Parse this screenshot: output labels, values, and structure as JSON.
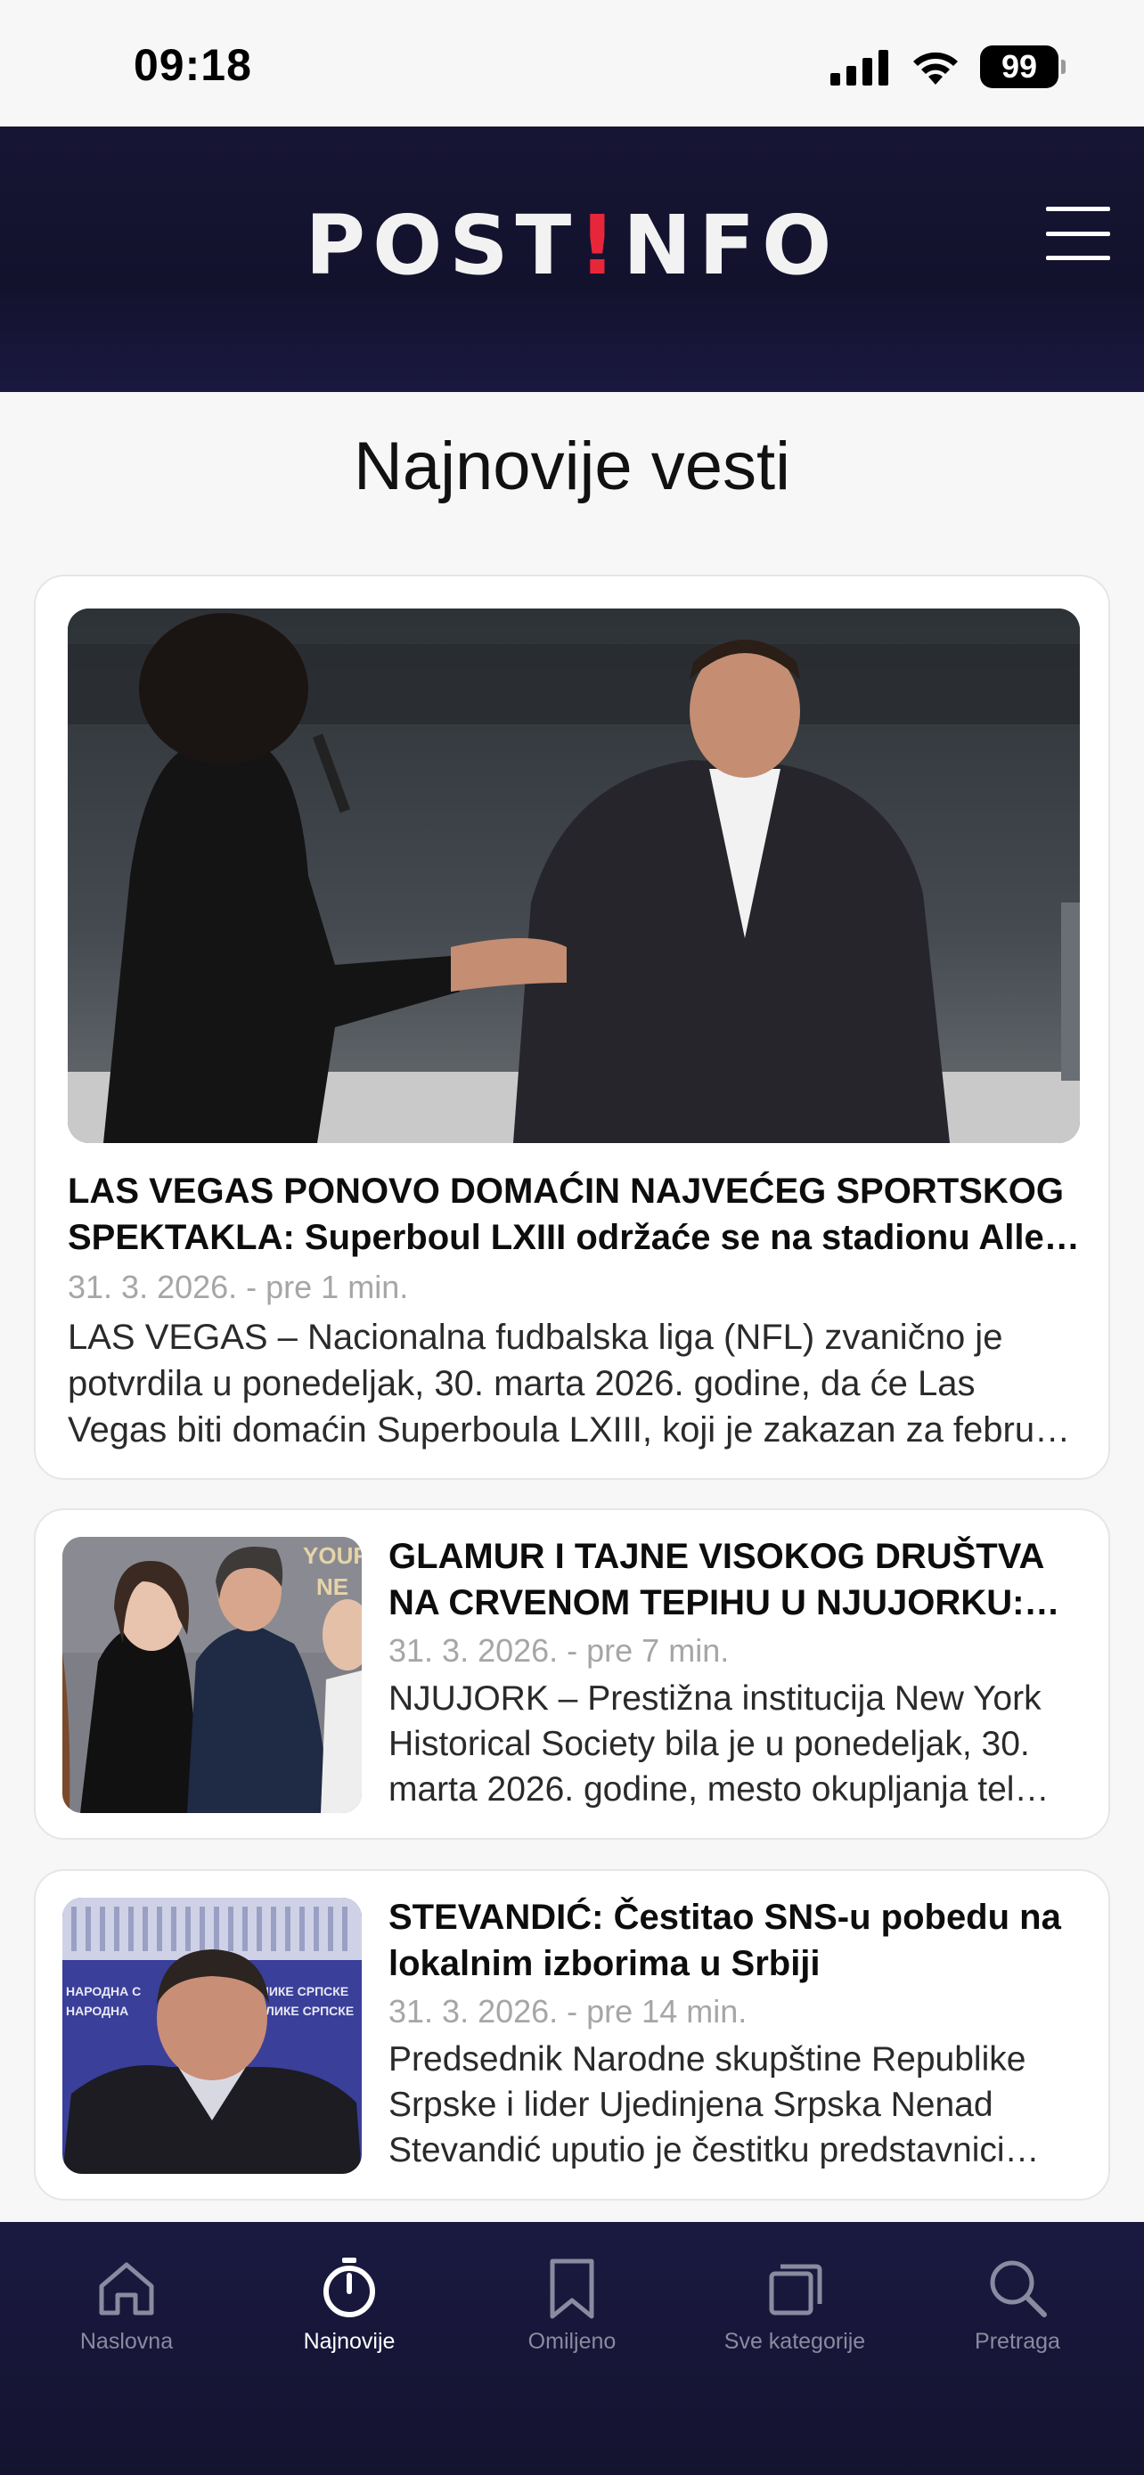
{
  "status_bar": {
    "time": "09:18",
    "battery": "99"
  },
  "header": {
    "logo_part1": "POST",
    "logo_part2": "!",
    "logo_part3": "NFO"
  },
  "page": {
    "title": "Najnovije vesti"
  },
  "articles": [
    {
      "title": "LAS VEGAS PONOVO DOMAĆIN NAJVEĆEG SPORTSKOG SPEKTAKLA: Superboul LXIII održaće se na stadionu Alle…",
      "date": "31. 3. 2026. - pre 1 min.",
      "excerpt": "LAS VEGAS – Nacionalna fudbalska liga (NFL) zvanično je potvrdila u ponedeljak, 30. marta 2026. godine, da će Las Vegas biti domaćin Superboula LXIII, koji je zakazan za febru…"
    },
    {
      "title": "GLAMUR I TAJNE VISOKOG DRUŠTVA NA CRVENOM TEPIHU U NJUJORKU: D…",
      "date": "31. 3. 2026. - pre 7 min.",
      "excerpt": "NJUJORK – Prestižna institucija New York Historical Society bila je u ponedeljak, 30. marta 2026. godine, mesto okupljanja tel…",
      "image_text": "YOUR NE"
    },
    {
      "title": "STEVANDIĆ: Čestitao SNS-u pobedu na lokalnim izborima u Srbiji",
      "date": "31. 3. 2026. - pre 14 min.",
      "excerpt": "Predsednik Narodne skupštine Republike Srpske i lider Ujedinjena Srpska Nenad Stevandić uputio je čestitku predstavnici…",
      "image_text_left": "НАРОДНА С НАРОДНА",
      "image_text_right": "ЛИКЕ СРПСКЕ ЛИКЕ СРПСКЕ"
    }
  ],
  "bottom_nav": [
    {
      "label": "Naslovna",
      "icon": "home-icon",
      "active": false
    },
    {
      "label": "Najnovije",
      "icon": "stopwatch-icon",
      "active": true
    },
    {
      "label": "Omiljeno",
      "icon": "bookmark-icon",
      "active": false
    },
    {
      "label": "Sve kategorije",
      "icon": "categories-icon",
      "active": false
    },
    {
      "label": "Pretraga",
      "icon": "search-icon",
      "active": false
    }
  ],
  "colors": {
    "header_bg": "#161533",
    "accent_red": "#e8263a",
    "nav_active": "#ffffff",
    "nav_inactive": "#8a8aa0"
  }
}
